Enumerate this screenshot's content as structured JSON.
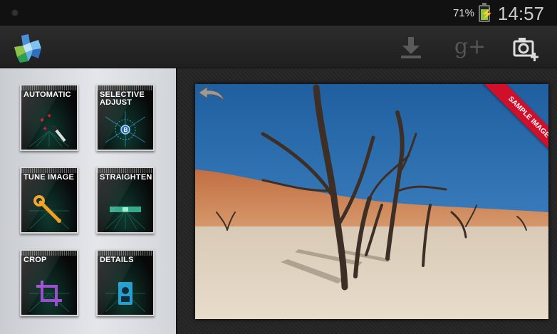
{
  "status_bar": {
    "battery_percent": "71%",
    "time": "14:57"
  },
  "action_bar": {
    "app_logo_icon": "snapseed-logo-icon",
    "actions": [
      {
        "icon": "download-icon"
      },
      {
        "icon": "google-plus-icon",
        "label": "g+"
      },
      {
        "icon": "camera-add-icon"
      }
    ]
  },
  "tools": [
    {
      "label": "AUTOMATIC",
      "icon": "magic-wand-icon"
    },
    {
      "label": "SELECTIVE ADJUST",
      "icon": "control-point-icon"
    },
    {
      "label": "TUNE IMAGE",
      "icon": "wrench-icon"
    },
    {
      "label": "STRAIGHTEN",
      "icon": "level-icon"
    },
    {
      "label": "CROP",
      "icon": "crop-icon"
    },
    {
      "label": "DETAILS",
      "icon": "sharpener-icon"
    }
  ],
  "image": {
    "banner": "SAMPLE IMAGE",
    "undo_icon": "undo-icon"
  },
  "colors": {
    "sky": "#2d6fb3",
    "dune": "#c97b4c",
    "sand": "#e0d3c0",
    "banner": "#d0102a",
    "battery": "#8cc63f"
  }
}
